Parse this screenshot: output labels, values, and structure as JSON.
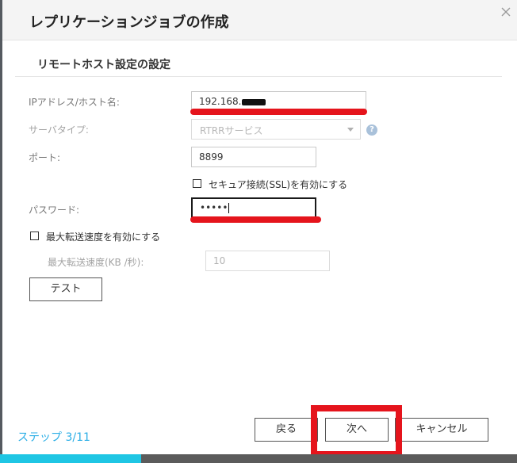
{
  "dialog": {
    "title": "レプリケーションジョブの作成",
    "section_title": "リモートホスト設定の設定"
  },
  "form": {
    "ip_label": "IPアドレス/ホスト名:",
    "ip_value": "192.168.",
    "server_type_label": "サーバタイプ:",
    "server_type_value": "RTRRサービス",
    "port_label": "ポート:",
    "port_value": "8899",
    "ssl_label": "セキュア接続(SSL)を有効にする",
    "password_label": "パスワード:",
    "password_value": "•••••",
    "max_speed_checkbox_label": "最大転送速度を有効にする",
    "max_speed_label": "最大転送速度(KB /秒):",
    "max_speed_value": "10",
    "test_button": "テスト"
  },
  "footer": {
    "step_text": "ステップ 3/11",
    "back_button": "戻る",
    "next_button": "次へ",
    "cancel_button": "キャンセル",
    "progress_fraction": 0.2727
  },
  "colors": {
    "accent": "#1fc6e4",
    "step_text": "#2baee6",
    "annotation_red": "#e5141c"
  },
  "icons": {
    "close": "close-icon",
    "help": "help-icon"
  }
}
